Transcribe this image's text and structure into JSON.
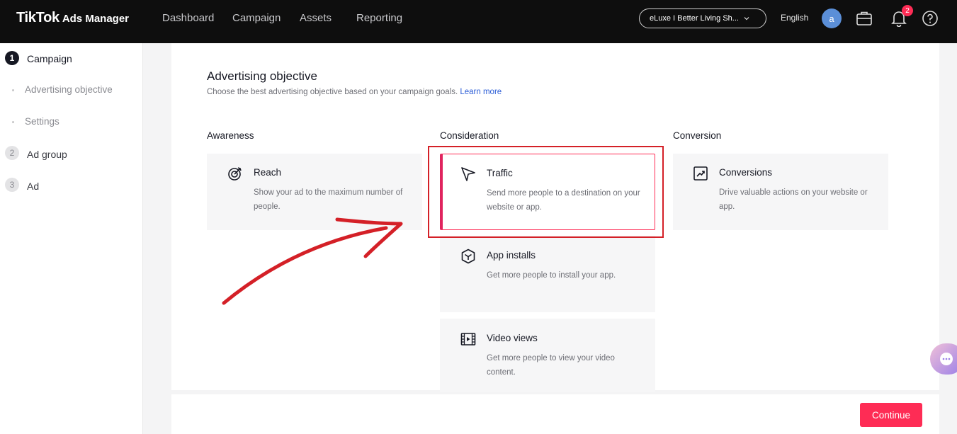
{
  "header": {
    "logo_main": "TikTok",
    "logo_sub": "Ads Manager",
    "nav": [
      "Dashboard",
      "Campaign",
      "Assets",
      "Reporting"
    ],
    "account": "eLuxe I Better Living Sh...",
    "language": "English",
    "avatar_letter": "a",
    "notification_count": "2"
  },
  "sidebar": {
    "steps": [
      {
        "num": "1",
        "label": "Campaign"
      },
      {
        "num": "2",
        "label": "Ad group"
      },
      {
        "num": "3",
        "label": "Ad"
      }
    ],
    "substeps": [
      "Advertising objective",
      "Settings"
    ]
  },
  "main": {
    "title": "Advertising objective",
    "subtitle": "Choose the best advertising objective based on your campaign goals.",
    "learn_more": "Learn more",
    "columns": [
      "Awareness",
      "Consideration",
      "Conversion"
    ],
    "objectives": {
      "reach": {
        "title": "Reach",
        "desc": "Show your ad to the maximum number of people."
      },
      "traffic": {
        "title": "Traffic",
        "desc": "Send more people to a destination on your website or app."
      },
      "app_installs": {
        "title": "App installs",
        "desc": "Get more people to install your app."
      },
      "video_views": {
        "title": "Video views",
        "desc": "Get more people to view your video content."
      },
      "conversions": {
        "title": "Conversions",
        "desc": "Drive valuable actions on your website or app."
      }
    }
  },
  "footer": {
    "continue_label": "Continue"
  },
  "colors": {
    "accent": "#fe2c55",
    "annotation": "#d42027"
  },
  "icons": [
    "reach-icon",
    "traffic-icon",
    "app-installs-icon",
    "video-views-icon",
    "conversions-icon"
  ]
}
